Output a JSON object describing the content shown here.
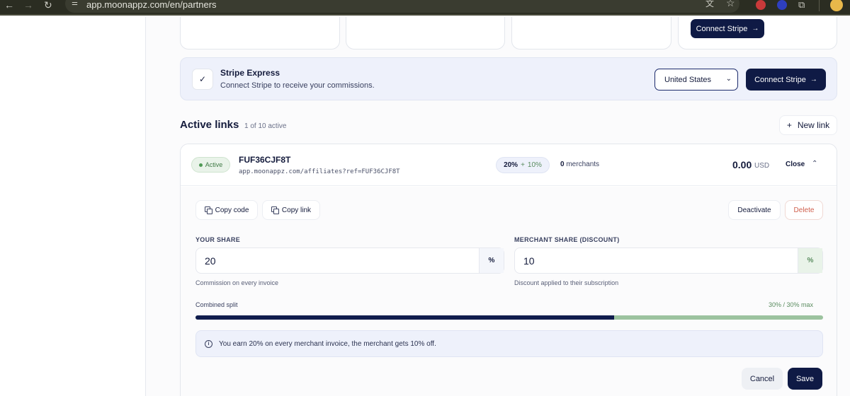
{
  "browser": {
    "url": "app.moonappz.com/en/partners",
    "back_icon": "←",
    "forward_icon": "→",
    "reload_icon": "↻",
    "site_icon": "⚌",
    "translate_icon": "文",
    "bookmark_icon": "☆",
    "extensions_icon": "⧉"
  },
  "top_cards": {
    "connect_label": "Connect Stripe",
    "arrow": "→"
  },
  "stripe_express": {
    "check": "✓",
    "title": "Stripe Express",
    "subtitle": "Connect Stripe to receive your commissions.",
    "country": "United States",
    "country_chevron": "⌄",
    "connect_label": "Connect Stripe",
    "arrow": "→"
  },
  "active_links": {
    "title": "Active links",
    "count": "1 of 10 active",
    "new_link_plus": "+",
    "new_link_label": "New link"
  },
  "link": {
    "status": "Active",
    "code": "FUF36CJF8T",
    "url": "app.moonappz.com/affiliates?ref=FUF36CJF8T",
    "pct_main": "20%",
    "pct_plus": "+",
    "pct_secondary": "10%",
    "merchants_count": "0",
    "merchants_label": "merchants",
    "amount": "0.00",
    "currency": "USD",
    "close_label": "Close",
    "close_chevron": "⌃"
  },
  "actions": {
    "copy_code": "Copy code",
    "copy_link": "Copy link",
    "deactivate": "Deactivate",
    "delete": "Delete"
  },
  "your_share": {
    "label": "YOUR SHARE",
    "value": "20",
    "suffix": "%",
    "help": "Commission on every invoice"
  },
  "merchant_share": {
    "label": "MERCHANT SHARE (DISCOUNT)",
    "value": "10",
    "suffix": "%",
    "help": "Discount applied to their subscription"
  },
  "split": {
    "label": "Combined split",
    "value_text": "30% / 30% max",
    "filled_fraction": 0.667
  },
  "info": {
    "icon": "i",
    "text": "You earn 20% on every merchant invoice, the merchant gets 10% off."
  },
  "footer": {
    "cancel": "Cancel",
    "save": "Save"
  },
  "colors": {
    "accent_dark": "#0f1a45",
    "green": "#5a8c5f",
    "danger": "#d0604e",
    "info_bg": "#eef1fb"
  }
}
